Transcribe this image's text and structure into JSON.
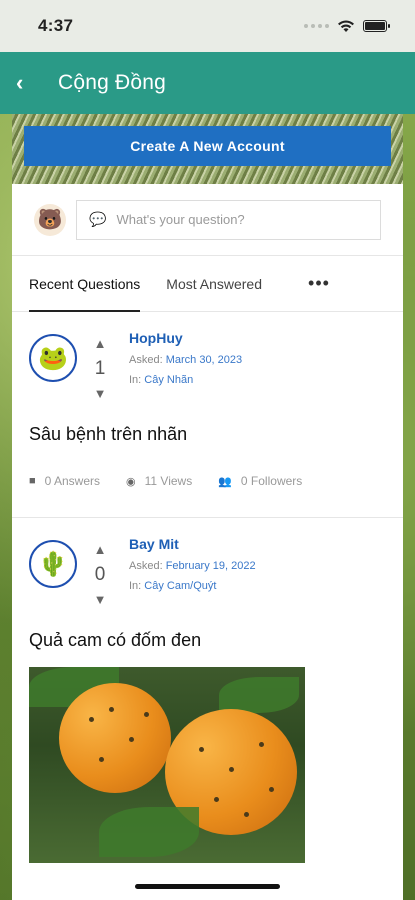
{
  "status_bar": {
    "time": "4:37"
  },
  "header": {
    "title": "Cộng Đồng",
    "back_icon": "chevron-left-icon"
  },
  "banner": {
    "create_label": "Create A New Account"
  },
  "ask": {
    "placeholder": "What's your question?"
  },
  "tabs": [
    {
      "label": "Recent Questions",
      "active": true
    },
    {
      "label": "Most Answered",
      "active": false
    }
  ],
  "more_label": "•••",
  "questions": [
    {
      "author": "HopHuy",
      "votes": "1",
      "asked_prefix": "Asked:",
      "asked_date": "March 30, 2023",
      "in_prefix": "In:",
      "category": "Cây Nhãn",
      "title": "Sâu bệnh trên nhãn",
      "answers": "0 Answers",
      "views": "11 Views",
      "followers": "0 Followers"
    },
    {
      "author": "Bay Mit",
      "votes": "0",
      "asked_prefix": "Asked:",
      "asked_date": "February 19, 2022",
      "in_prefix": "In:",
      "category": "Cây Cam/Quýt",
      "title": "Quả cam có đốm đen"
    }
  ],
  "colors": {
    "header": "#2a9a87",
    "button": "#1f6fc2",
    "link": "#1e5fb5"
  }
}
